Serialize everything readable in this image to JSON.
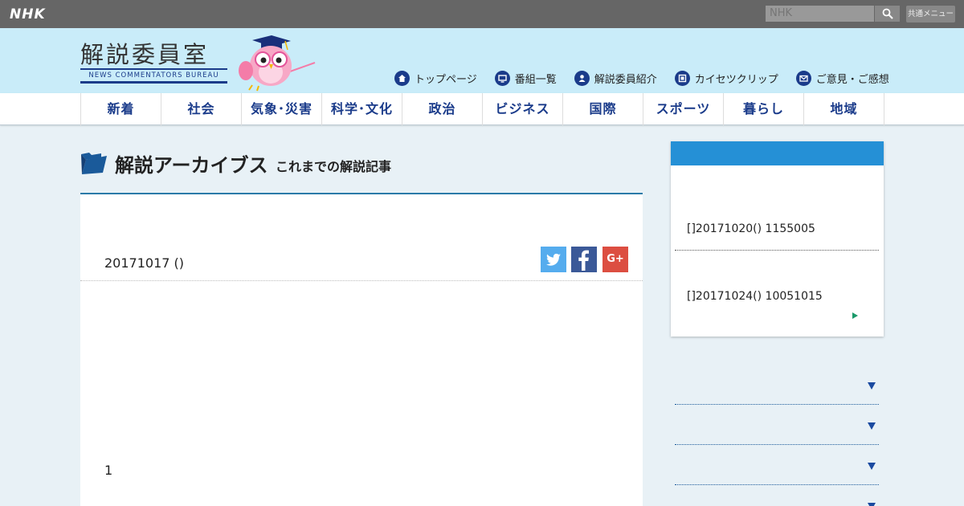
{
  "topbar": {
    "logo": "NHK",
    "search_placeholder": "NHK",
    "common_menu_label": "共通メニュー"
  },
  "header": {
    "site_title": "解説委員室",
    "site_subtitle": "NEWS COMMENTATORS BUREAU",
    "nav_links": [
      {
        "label": "トップページ",
        "icon": "home-icon"
      },
      {
        "label": "番組一覧",
        "icon": "tv-icon"
      },
      {
        "label": "解説委員紹介",
        "icon": "person-icon"
      },
      {
        "label": "カイセツクリップ",
        "icon": "film-icon"
      },
      {
        "label": "ご意見・ご感想",
        "icon": "mail-icon"
      }
    ]
  },
  "categories": [
    "新着",
    "社会",
    "気象･災害",
    "科学･文化",
    "政治",
    "ビジネス",
    "国際",
    "スポーツ",
    "暮らし",
    "地域"
  ],
  "main": {
    "archive_title": "解説アーカイブス",
    "archive_subtitle": "これまでの解説記事",
    "article_date": "20171017 ()",
    "page_number": "1"
  },
  "sidebar": {
    "items": [
      {
        "text": "[]20171020() 1155005"
      },
      {
        "text": "[]20171024() 10051015"
      }
    ]
  },
  "colors": {
    "topbar": "#666666",
    "header_bg": "#c9ecf9",
    "brand_blue": "#1a3b8a",
    "sidebar_head": "#2590d6",
    "twitter": "#55acee",
    "facebook": "#3b5998",
    "google_plus": "#dc4e41"
  }
}
